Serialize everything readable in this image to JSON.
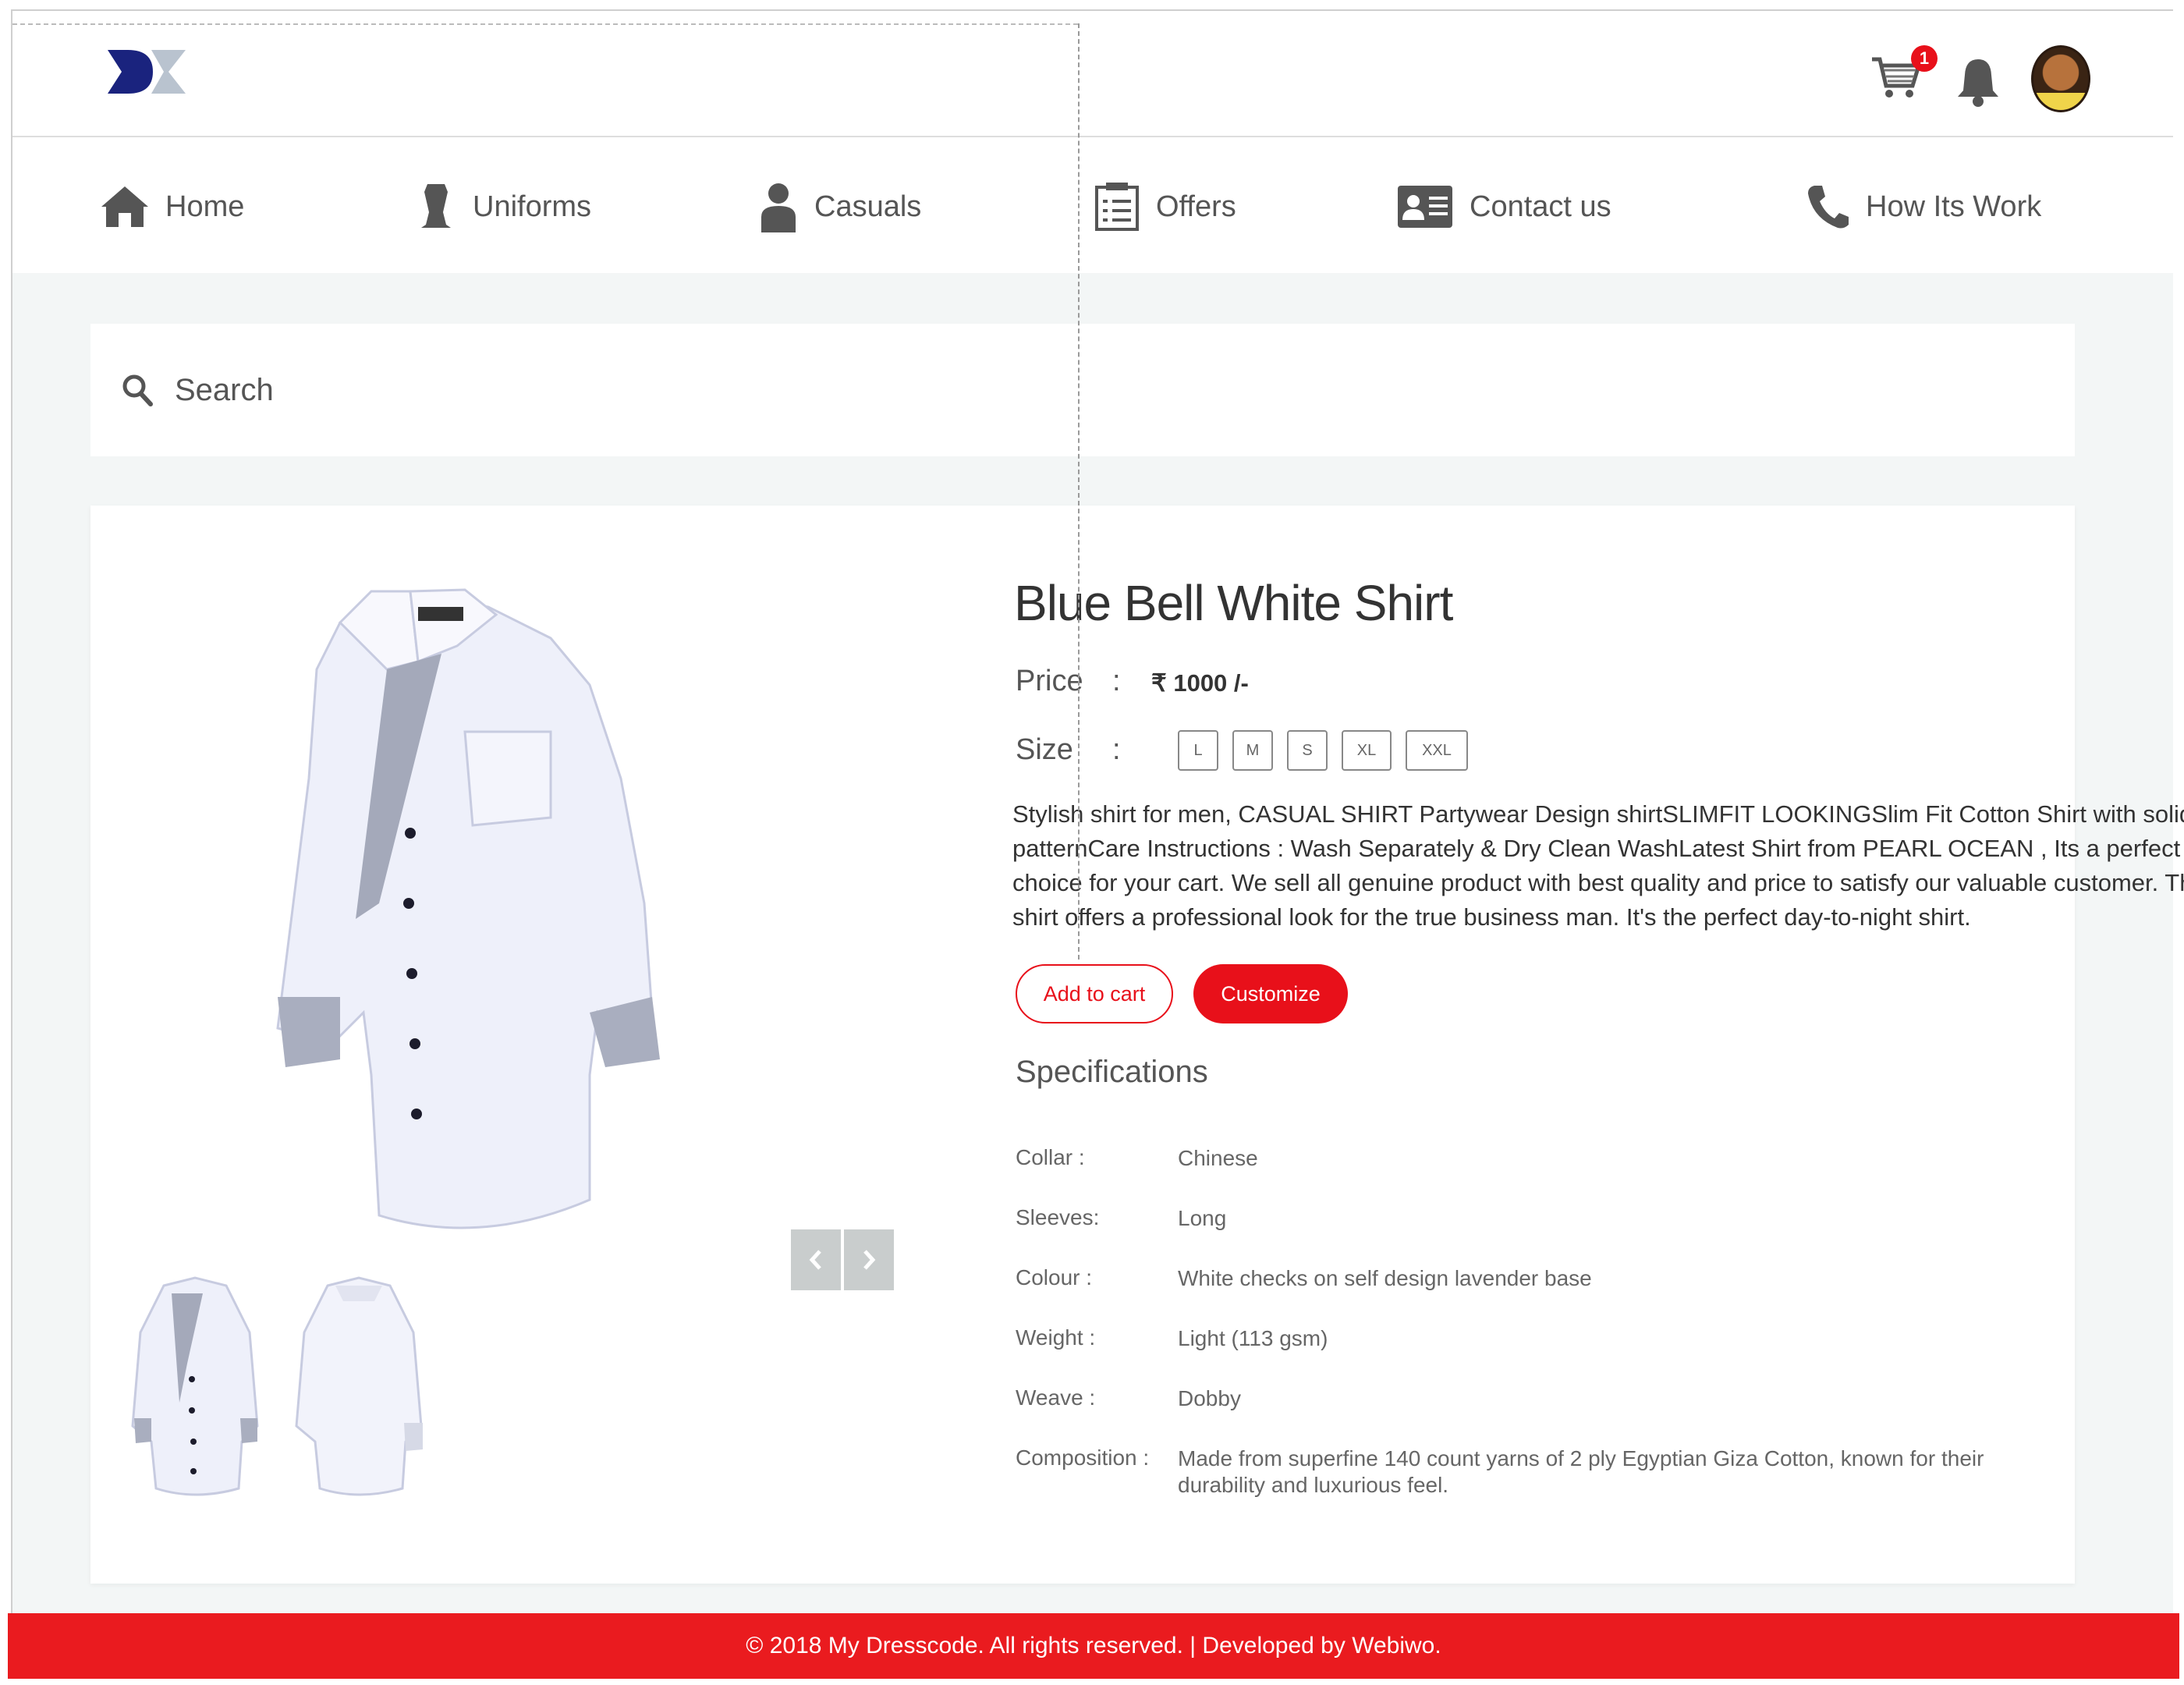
{
  "header": {
    "cart_badge": "1",
    "brand_color": "#1a237e",
    "accent": "#e8101a"
  },
  "nav": {
    "items": [
      {
        "label": "Home",
        "icon": "home-icon"
      },
      {
        "label": "Uniforms",
        "icon": "uniform-icon"
      },
      {
        "label": "Casuals",
        "icon": "person-icon"
      },
      {
        "label": "Offers",
        "icon": "list-icon"
      },
      {
        "label": "Contact us",
        "icon": "contact-card-icon"
      },
      {
        "label": "How Its Work",
        "icon": "phone-icon"
      }
    ]
  },
  "search": {
    "placeholder": "Search"
  },
  "product": {
    "title": "Blue Bell White Shirt",
    "price_label": "Price",
    "price_value": "₹ 1000 /-",
    "size_label": "Size",
    "colon": ":",
    "sizes": [
      "L",
      "M",
      "S",
      "XL",
      "XXL"
    ],
    "description": "Stylish shirt for men, CASUAL SHIRT Partywear Design shirtSLIMFIT LOOKINGSlim Fit Cotton Shirt with solid patternCare Instructions : Wash Separately & Dry Clean WashLatest Shirt from PEARL OCEAN , Its a perfect choice for your cart. We sell all genuine product with best quality and price to satisfy our valuable customer. This shirt offers a professional look for the true business man. It's the perfect day-to-night shirt.",
    "add_to_cart": "Add to cart",
    "customize": "Customize",
    "specs_heading": "Specifications",
    "specs": [
      {
        "key": "Collar :",
        "value": "Chinese"
      },
      {
        "key": "Sleeves:",
        "value": "Long"
      },
      {
        "key": "Colour :",
        "value": "White checks on self design lavender base"
      },
      {
        "key": "Weight :",
        "value": "Light (113 gsm)"
      },
      {
        "key": "Weave :",
        "value": "Dobby"
      },
      {
        "key": "Composition :",
        "value": "Made from superfine 140 count yarns of 2 ply Egyptian Giza Cotton, known for their durability and luxurious feel."
      }
    ]
  },
  "footer": {
    "text": "© 2018 My Dresscode. All rights reserved. | Developed by Webiwo."
  }
}
